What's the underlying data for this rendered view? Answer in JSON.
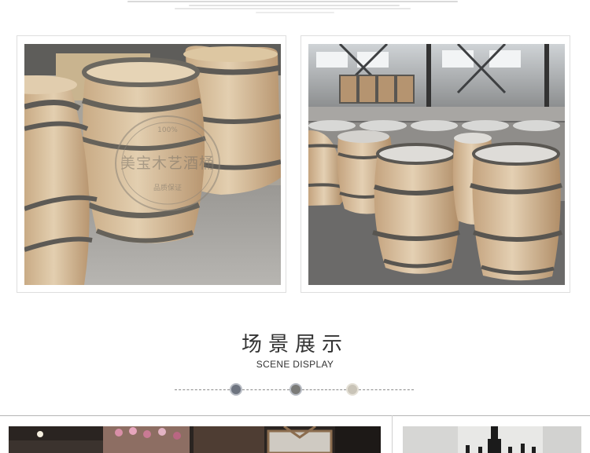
{
  "product_photos": {
    "left": {
      "watermark_line1": "100%",
      "watermark_main": "美宝木艺酒桶",
      "watermark_line3": "品质保证"
    },
    "right": {}
  },
  "section": {
    "title": "场景展示",
    "subtitle": "SCENE DISPLAY",
    "dot_colors": [
      "#6e7480",
      "#7b7b78",
      "#c9c4b8"
    ]
  },
  "colors": {
    "frame_border": "#dedede",
    "oak_light": "#d9c2a0",
    "hoop": "#6f6a62"
  }
}
